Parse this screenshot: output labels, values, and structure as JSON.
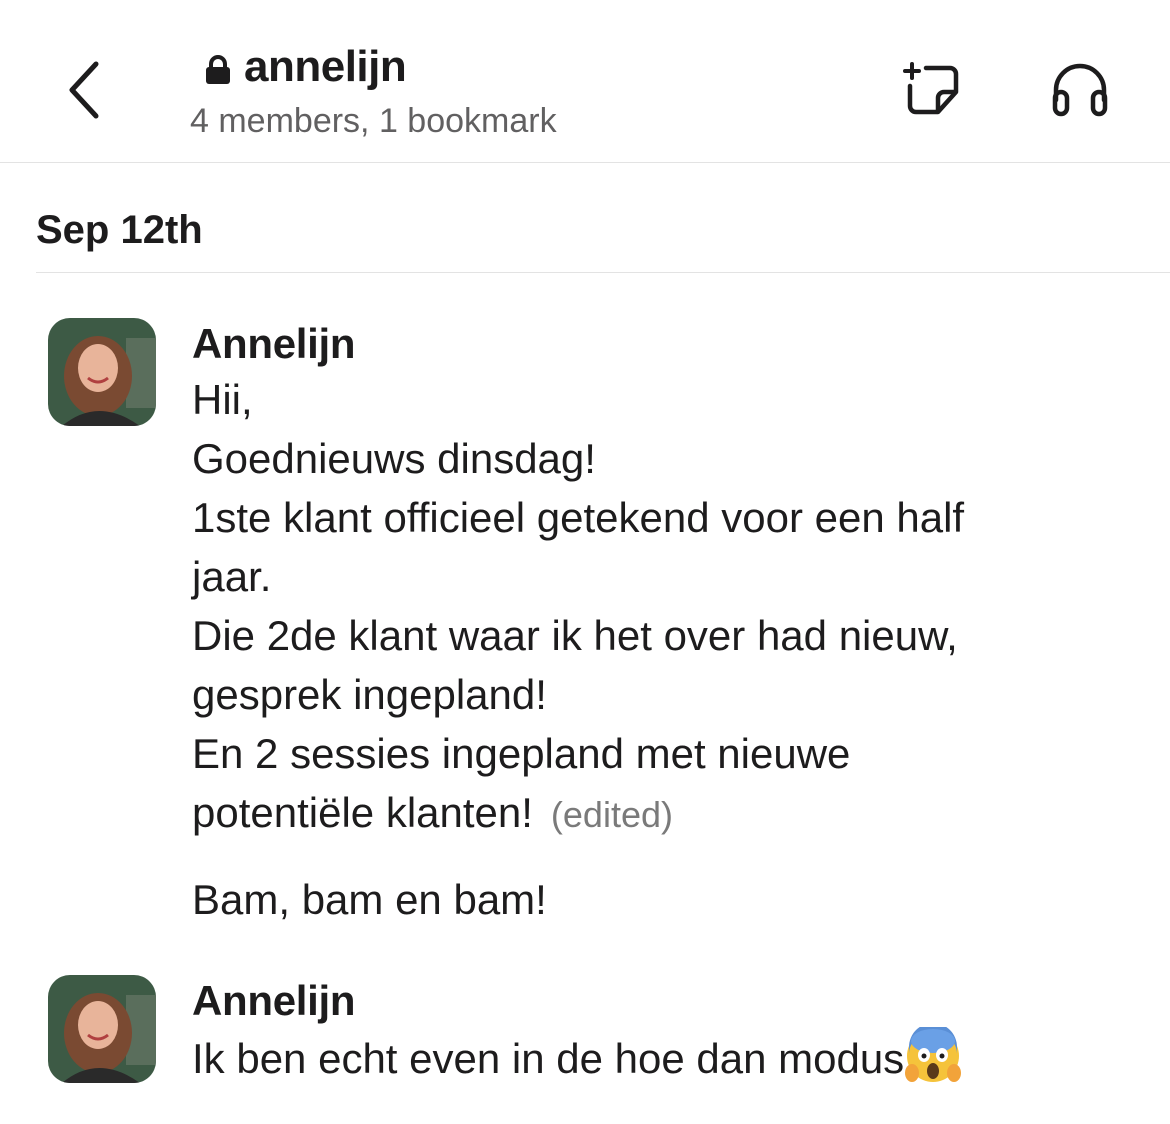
{
  "header": {
    "channel_name": "annelijn",
    "meta": "4 members, 1 bookmark"
  },
  "date_divider": "Sep 12th",
  "messages": [
    {
      "author": "Annelijn",
      "lines": [
        "Hii,",
        "Goednieuws dinsdag!",
        "1ste klant officieel getekend voor een half",
        "jaar.",
        "Die 2de klant waar ik het over had nieuw,",
        "gesprek ingepland!",
        "En 2 sessies ingepland met nieuwe",
        "potentiële klanten!"
      ],
      "edited_label": "(edited)",
      "followup": "Bam, bam en bam!"
    },
    {
      "author": "Annelijn",
      "text": "Ik ben echt even in de hoe dan modus",
      "emoji": "face-screaming-in-fear"
    }
  ],
  "colors": {
    "text": "#1d1c1d",
    "muted": "#616061",
    "divider": "#e3e3e3"
  }
}
